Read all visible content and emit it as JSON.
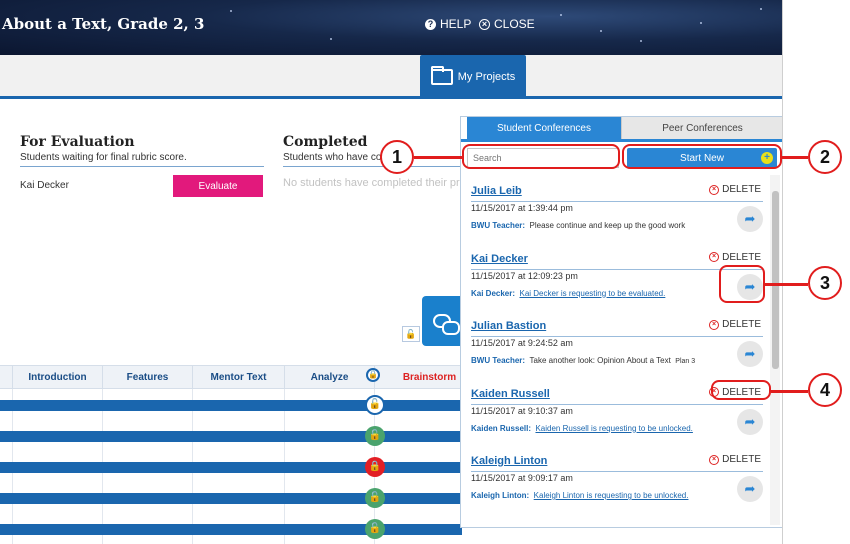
{
  "header": {
    "title": "About a Text, Grade 2, 3",
    "help_label": "HELP",
    "close_label": "CLOSE"
  },
  "nav": {
    "my_projects_label": "My Projects"
  },
  "for_evaluation": {
    "title": "For Evaluation",
    "subtitle": "Students waiting for final rubric score.",
    "student": "Kai Decker",
    "button": "Evaluate"
  },
  "completed": {
    "title": "Completed",
    "subtitle": "Students who have co",
    "empty": "No students have completed their pr"
  },
  "grid": {
    "columns": [
      "Introduction",
      "Features",
      "Mentor Text",
      "Analyze",
      "Brainstorm"
    ]
  },
  "panel": {
    "tabs": [
      "Student Conferences",
      "Peer Conferences"
    ],
    "search_placeholder": "Search",
    "start_new_label": "Start New",
    "delete_label": "DELETE",
    "conferences": [
      {
        "name": "Julia Leib",
        "time": "11/15/2017 at 1:39:44 pm",
        "sender": "BWU Teacher:",
        "message": "Please continue and keep up the good work",
        "link": false,
        "extra": ""
      },
      {
        "name": "Kai Decker",
        "time": "11/15/2017 at 12:09:23 pm",
        "sender": "Kai Decker:",
        "message": "Kai Decker is requesting to be evaluated.",
        "link": true,
        "extra": ""
      },
      {
        "name": "Julian Bastion",
        "time": "11/15/2017 at 9:24:52 am",
        "sender": "BWU Teacher:",
        "message": "Take another look: Opinion About a Text",
        "link": false,
        "extra": "Plan 3"
      },
      {
        "name": "Kaiden Russell",
        "time": "11/15/2017 at 9:10:37 am",
        "sender": "Kaiden Russell:",
        "message": "Kaiden Russell is requesting to be unlocked.",
        "link": true,
        "extra": ""
      },
      {
        "name": "Kaleigh Linton",
        "time": "11/15/2017 at 9:09:17 am",
        "sender": "Kaleigh Linton:",
        "message": "Kaleigh Linton is requesting to be unlocked.",
        "link": true,
        "extra": ""
      }
    ]
  },
  "callouts": [
    "1",
    "2",
    "3",
    "4"
  ],
  "colors": {
    "primary": "#1a66ae",
    "accent_blue": "#2a86d4",
    "evaluate": "#e2197c",
    "callout": "#e11d1d"
  }
}
